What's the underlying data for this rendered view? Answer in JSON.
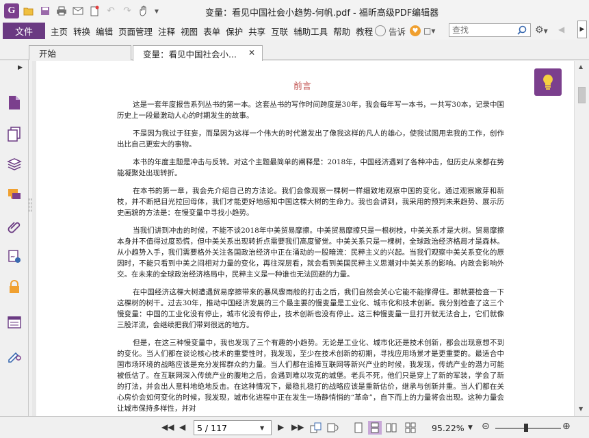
{
  "window": {
    "title": "变量：看见中国社会小趋势-何帆.pdf - 福昕高级PDF编辑器"
  },
  "menubar": {
    "file": "文件",
    "items": [
      "主页",
      "转换",
      "编辑",
      "页面管理",
      "注释",
      "视图",
      "表单",
      "保护",
      "共享",
      "互联",
      "辅助工具",
      "帮助",
      "教程"
    ],
    "tell_me": "告诉",
    "search_placeholder": "查找"
  },
  "tabs": [
    {
      "label": "开始"
    },
    {
      "label": "变量：看见中国社会小..."
    }
  ],
  "document": {
    "heading": "前言",
    "paragraphs": [
      "这是一套年度报告系列丛书的第一本。这套丛书的写作时间跨度是30年，我会每年写一本书，一共写30本，记录中国历史上一段最激动人心的时期发生的故事。",
      "不是因为我过于狂妄，而是因为这样一个伟大的时代激发出了像我这样的凡人的雄心，使我试图用忠我的工作，创作出比自己更宏大的事物。",
      "本书的年度主题是冲击与反转。对这个主题最简单的阐释是：2018年，中国经济遇到了各种冲击，但历史从来都在势能凝聚处出现转折。",
      "在本书的第一章，我会先介绍自己的方法论。我们会像观察一棵树一样细致地观察中国的变化。通过观察嫩芽和新枝，并不断把目光拉回母体，我们才能更好地感知中国这棵大树的生命力。我也会讲到，我采用的预判未来趋势、展示历史画貌的方法是：在慢变量中寻找小趋势。",
      "当我们讲到冲击的时候，不能不谈2018年中美贸易摩擦。中美贸易摩擦只是一根树枝，中美关系才是大树。贸易摩擦本身并不值得过度恐慌，但中美关系出现转折点需要我们高度警觉。中美关系只是一棵树，全球政治经济格局才是森林。从小趋势入手，我们需要格外关注各国政治经济中正在涌动的一股暗流：民粹主义的兴起。当我们观察中美关系变化的原因时，不能只看到中美之间相对力量的变化，再往深层看，就会看到美国民粹主义思潮对中美关系的影响。内政会影响外交。在未来的全球政治经济格局中，民粹主义是一种谁也无法回避的力量。",
      "在中国经济这棵大树遭遇贸易摩擦带来的暴风骤雨般的打击之后，我们自然会关心它能不能撑得住。那就要检查一下这棵树的树干。过去30年，推动中国经济发展的三个最主要的慢变量是工业化、城市化和技术创新。我分别检查了这三个慢变量：中国的工业化没有停止，城市化没有停止，技术创新也没有停止。这三种慢变量一旦打开就无法合上，它们就像三股洋流，会继续把我们带到很远的地方。",
      "但是，在这三种慢变量中，我也发现了三个有趣的小趋势。无论是工业化、城市化还是技术创新，都会出现意想不到的变化。当人们都在谈论核心技术的重要性时，我发现，至少在技术创新的初期，寻找应用场景才是更重要的。最适合中国市场环境的战略应该是充分发挥群众的力量。当人们都在追捧互联网等新兴产业的时候，我发现，传统产业的潜力可能被低估了。在互联网深入传统产业的腹地之后，会遇到难以攻克的城堡。老兵不死，他们只是穿上了新的军装，学会了新的打法，并会出人意料地绝地反击。在这种情况下，最稳扎稳打的战略应该是重新估价，继承与创新并重。当人们都在关心房价会如何变化的时候，我发现，城市化进程中正在发生一场静悄悄的“革命”，自下而上的力量将会出现。这种力量会让城市保持多样性，并对"
    ]
  },
  "statusbar": {
    "page_value": "5 / 117",
    "zoom": "95.22%"
  },
  "colors": {
    "brand": "#7b3f8d",
    "heading": "#c0504d"
  }
}
